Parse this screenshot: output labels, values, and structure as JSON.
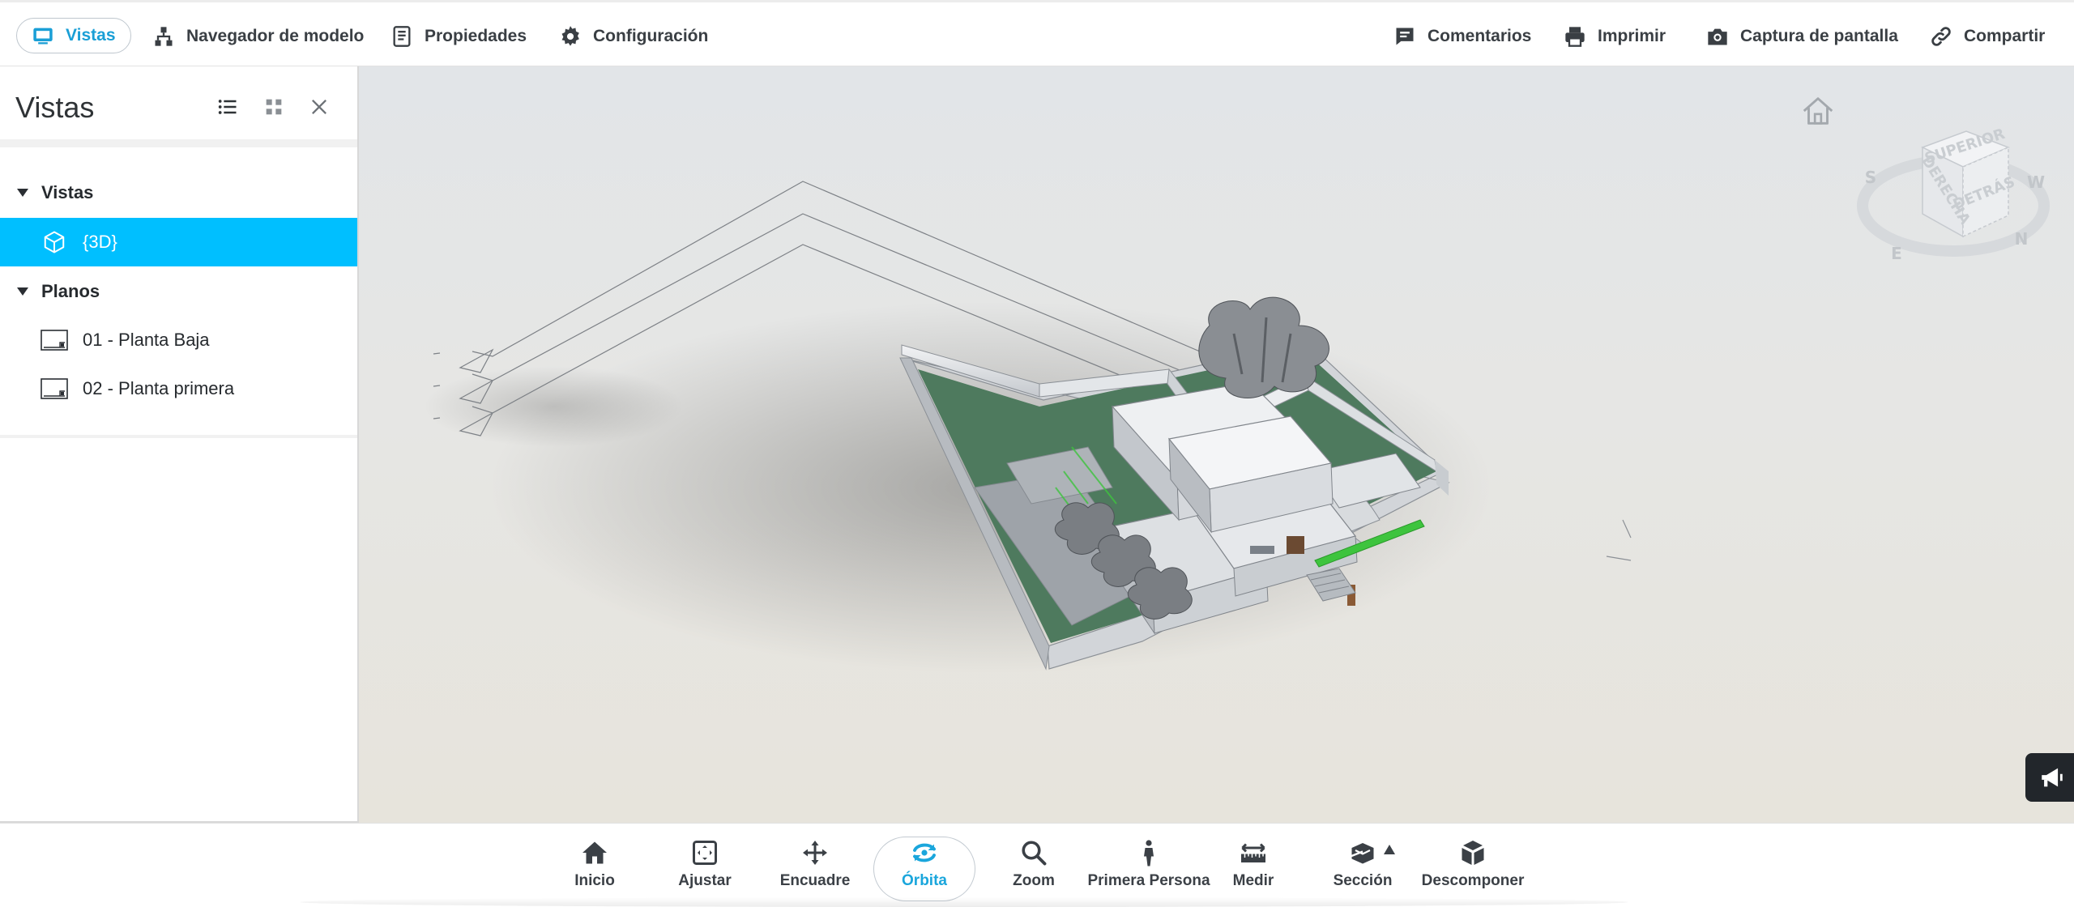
{
  "top_toolbar": {
    "left": [
      {
        "label": "Vistas",
        "icon": "views-icon",
        "active": true
      },
      {
        "label": "Navegador de modelo",
        "icon": "model-browser-icon"
      },
      {
        "label": "Propiedades",
        "icon": "properties-icon"
      },
      {
        "label": "Configuración",
        "icon": "gear-icon"
      }
    ],
    "right": [
      {
        "label": "Comentarios",
        "icon": "comment-icon"
      },
      {
        "label": "Imprimir",
        "icon": "printer-icon"
      },
      {
        "label": "Captura de pantalla",
        "icon": "camera-icon"
      },
      {
        "label": "Compartir",
        "icon": "link-icon"
      }
    ]
  },
  "panel": {
    "title": "Vistas",
    "groups": [
      {
        "label": "Vistas",
        "items": [
          {
            "label": "{3D}",
            "icon": "cube-icon",
            "selected": true
          }
        ]
      },
      {
        "label": "Planos",
        "items": [
          {
            "label": "01 - Planta Baja",
            "icon": "sheet-icon"
          },
          {
            "label": "02 - Planta primera",
            "icon": "sheet-icon"
          }
        ]
      }
    ]
  },
  "viewcube": {
    "faces": [
      "SUPERIOR",
      "DERECHA",
      "DETRÁS"
    ],
    "compass": [
      "S",
      "W",
      "N",
      "E"
    ]
  },
  "bottom_toolbar": {
    "items": [
      {
        "label": "Inicio",
        "icon": "home-icon"
      },
      {
        "label": "Ajustar",
        "icon": "fit-icon"
      },
      {
        "label": "Encuadre",
        "icon": "pan-icon"
      },
      {
        "label": "Órbita",
        "icon": "orbit-icon",
        "active": true
      },
      {
        "label": "Zoom",
        "icon": "zoom-icon"
      },
      {
        "label": "Primera Persona",
        "icon": "person-icon"
      },
      {
        "label": "Medir",
        "icon": "measure-icon"
      },
      {
        "label": "Sección",
        "icon": "section-icon"
      },
      {
        "label": "Descomponer",
        "icon": "explode-icon"
      }
    ]
  },
  "colors": {
    "accent": "#1a9fd6",
    "selection": "#00bfff",
    "lawn": "#4e7a5e"
  }
}
